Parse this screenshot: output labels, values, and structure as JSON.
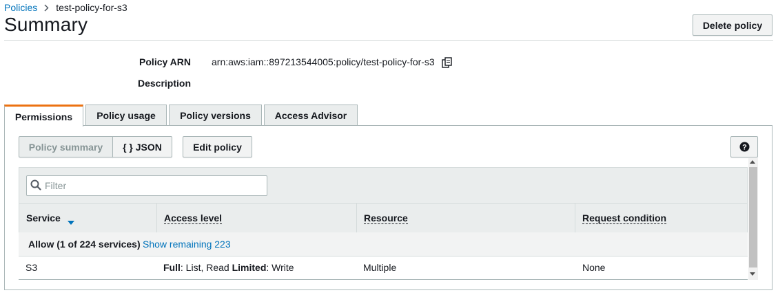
{
  "breadcrumb": {
    "parent": "Policies",
    "current": "test-policy-for-s3"
  },
  "page": {
    "title": "Summary",
    "delete_label": "Delete policy"
  },
  "properties": {
    "arn_label": "Policy ARN",
    "arn_value": "arn:aws:iam::897213544005:policy/test-policy-for-s3",
    "description_label": "Description",
    "copy_icon": "copy-icon"
  },
  "tabs": [
    {
      "label": "Permissions",
      "active": true
    },
    {
      "label": "Policy usage",
      "active": false
    },
    {
      "label": "Policy versions",
      "active": false
    },
    {
      "label": "Access Advisor",
      "active": false
    }
  ],
  "toolbar": {
    "policy_summary_label": "Policy summary",
    "json_label": "{ } JSON",
    "edit_policy_label": "Edit policy",
    "help_icon": "help-icon"
  },
  "filter": {
    "placeholder": "Filter"
  },
  "table": {
    "columns": [
      "Service",
      "Access level",
      "Resource",
      "Request condition"
    ],
    "group": {
      "label": "Allow (1 of 224 services)",
      "link": "Show remaining 223"
    },
    "rows": [
      {
        "service": "S3",
        "access_full_label": "Full",
        "access_full_value": ": List, Read ",
        "access_limited_label": "Limited",
        "access_limited_value": ": Write",
        "resource": "Multiple",
        "condition": "None"
      }
    ]
  },
  "colors": {
    "accent": "#ec7211",
    "link": "#0073bb",
    "border": "#aab7b8",
    "header_bg": "#eaeded"
  }
}
